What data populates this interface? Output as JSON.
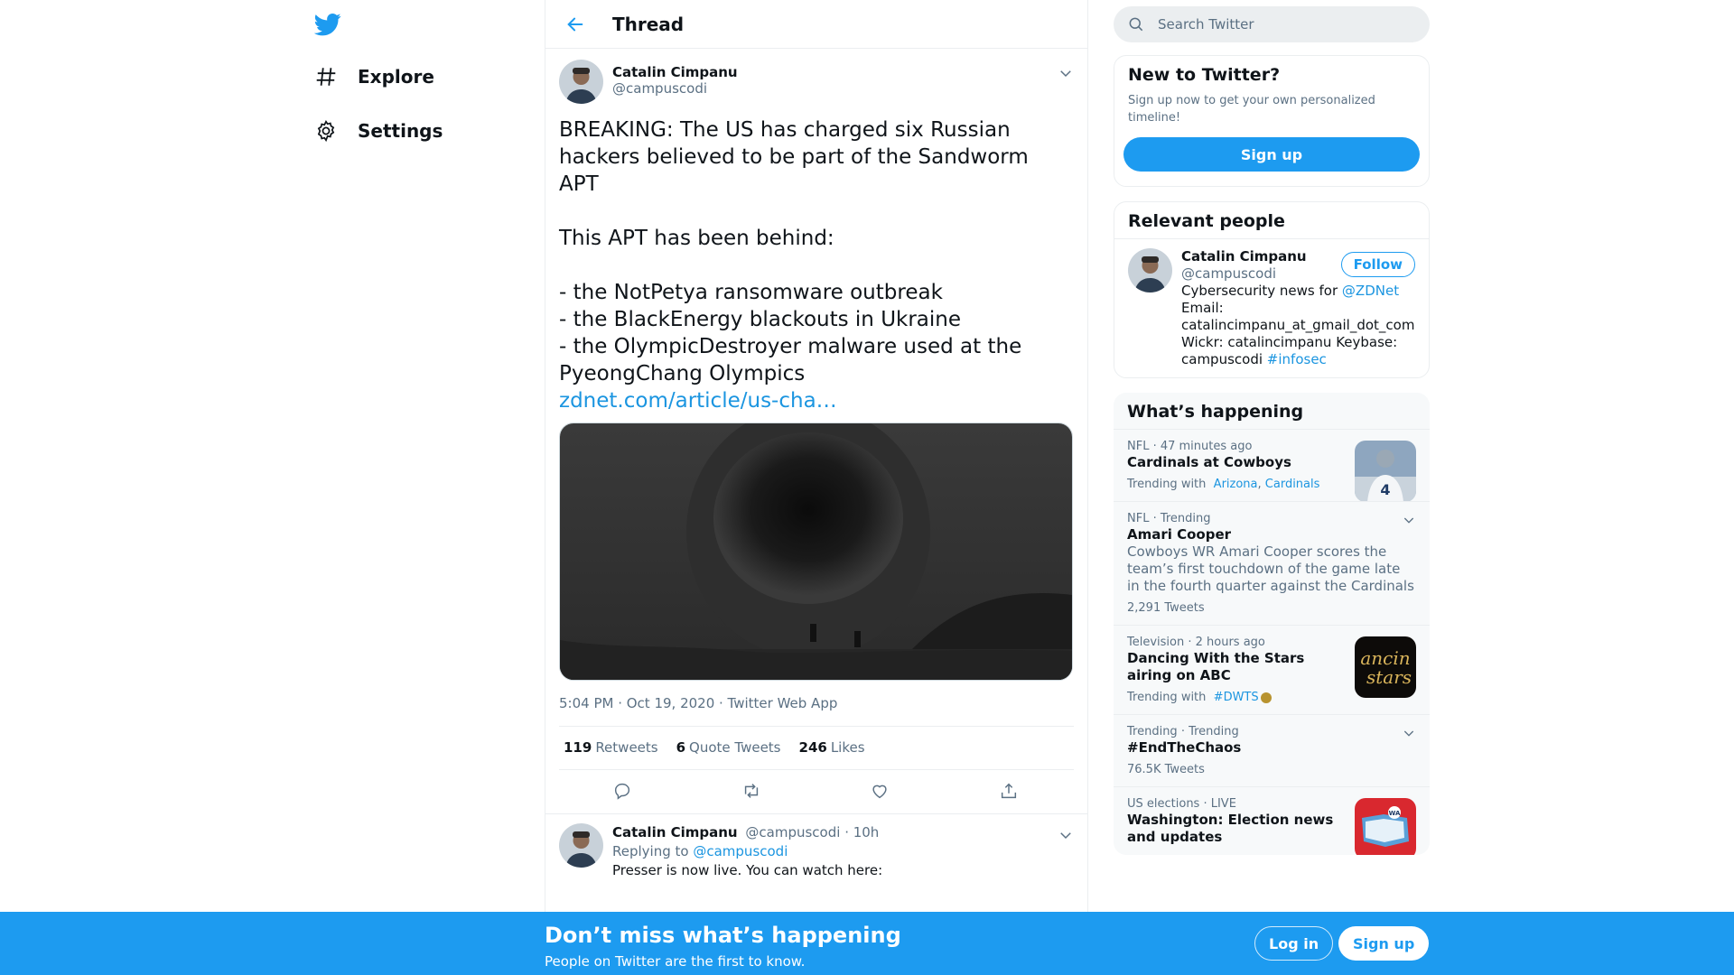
{
  "colors": {
    "brand": "#1d9bf0",
    "link": "#1b95e0",
    "text": "#0f1419",
    "muted": "#5b7083",
    "border": "#ebeef0"
  },
  "nav": {
    "logo_icon": "twitter-bird-icon",
    "items": [
      {
        "label": "Explore",
        "icon": "hashtag-icon"
      },
      {
        "label": "Settings",
        "icon": "gear-icon"
      }
    ]
  },
  "header": {
    "title": "Thread",
    "back_icon": "arrow-left-icon"
  },
  "tweet": {
    "author_name": "Catalin Cimpanu",
    "author_handle": "@campuscodi",
    "text": "BREAKING: The US has charged six Russian hackers believed to be part of the Sandworm APT\n\nThis APT has been behind:\n\n- the NotPetya ransomware outbreak\n- the BlackEnergy blackouts in Ukraine\n- the OlympicDestroyer malware used at the PyeongChang Olympics\n",
    "link": "zdnet.com/article/us-cha…",
    "meta": "5:04 PM · Oct 19, 2020 · Twitter Web App",
    "stats": [
      {
        "count": "119",
        "label": "Retweets"
      },
      {
        "count": "6",
        "label": "Quote Tweets"
      },
      {
        "count": "246",
        "label": "Likes"
      }
    ],
    "actions": [
      "reply-icon",
      "retweet-icon",
      "like-icon",
      "share-icon"
    ]
  },
  "reply": {
    "author_name": "Catalin Cimpanu",
    "author_handle": "@campuscodi",
    "time": "· 10h",
    "replying_prefix": "Replying to",
    "replying_to": "@campuscodi",
    "text": "Presser is now live. You can watch here:"
  },
  "search": {
    "placeholder": "Search Twitter"
  },
  "new_to_twitter": {
    "title": "New to Twitter?",
    "subtitle": "Sign up now to get your own personalized timeline!",
    "signup_label": "Sign up"
  },
  "relevant_people": {
    "title": "Relevant people",
    "person": {
      "name": "Catalin Cimpanu",
      "handle": "@campuscodi",
      "follow_label": "Follow",
      "bio_prefix": "Cybersecurity news for",
      "bio_mention": "@ZDNet",
      "bio_line2": "Email:",
      "bio_line3": "catalincimpanu_at_gmail_dot_com",
      "bio_line4": "Wickr: catalincimpanu Keybase:",
      "bio_line5": "campuscodi",
      "bio_hashtag": "#infosec"
    }
  },
  "whats_happening": {
    "title": "What’s happening",
    "trends": [
      {
        "category": "NFL · 47 minutes ago",
        "name": "Cardinals at Cowboys",
        "trending_prefix": "Trending with",
        "links": [
          "Arizona",
          "Cardinals"
        ],
        "has_thumb": true
      },
      {
        "category": "NFL · Trending",
        "name": "Amari Cooper",
        "description": "Cowboys WR Amari Cooper scores the team’s first touchdown of the game late in the fourth quarter against the Cardinals",
        "count": "2,291 Tweets"
      },
      {
        "category": "Television · 2 hours ago",
        "name": "Dancing With the Stars airing on ABC",
        "trending_prefix": "Trending with",
        "links": [
          "#DWTS"
        ],
        "has_thumb": true
      },
      {
        "category": "Trending · Trending",
        "name": "#EndTheChaos",
        "count": "76.5K Tweets"
      },
      {
        "category": "US elections · LIVE",
        "name": "Washington: Election news and updates",
        "has_thumb": true
      }
    ]
  },
  "bottom_bar": {
    "title": "Don’t miss what’s happening",
    "subtitle": "People on Twitter are the first to know.",
    "login_label": "Log in",
    "signup_label": "Sign up"
  }
}
